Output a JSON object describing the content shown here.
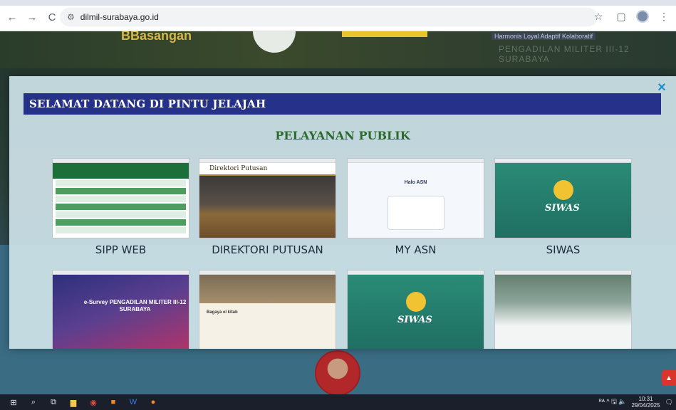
{
  "browser": {
    "url": "dilmil-surabaya.go.id",
    "nav": {
      "back": "←",
      "forward": "→",
      "reload": "C"
    },
    "icons": {
      "tune": "site-settings-icon",
      "star": "bookmark-star-icon",
      "extensions": "extensions-icon",
      "profile": "profile-avatar-icon",
      "menu": "kebab-menu-icon"
    }
  },
  "site_header": {
    "motto": "Harmonis Loyal Adaptif Kolaboratif",
    "subtitle": "PENGADILAN MILITER III-12 SURABAYA",
    "left_word": "BBasangan"
  },
  "modal": {
    "close_label": "×",
    "banner": "SELAMAT DATANG DI PINTU JELAJAH",
    "section_title": "PELAYANAN PUBLIK",
    "cards": [
      {
        "label": "SIPP WEB",
        "thumb": "sipp"
      },
      {
        "label": "DIREKTORI PUTUSAN",
        "thumb": "direktori",
        "thumb_title": "Direktori Putusan"
      },
      {
        "label": "MY ASN",
        "thumb": "myasn",
        "thumb_title": "Halo ASN"
      },
      {
        "label": "SIWAS",
        "thumb": "siwas",
        "thumb_title": "SIWAS"
      },
      {
        "label": "",
        "thumb": "survey",
        "thumb_title": "e-Survey PENGADILAN MILITER III-12 SURABAYA"
      },
      {
        "label": "",
        "thumb": "lapor",
        "thumb_title": "Bagaya el kitab"
      },
      {
        "label": "",
        "thumb": "siwas2",
        "thumb_title": "SIWAS"
      },
      {
        "label": "",
        "thumb": "map"
      }
    ]
  },
  "taskbar": {
    "time": "10:31",
    "date": "29/04/2025",
    "tray": "ᴿᴬ ^ 🖫 🔈"
  },
  "colors": {
    "banner": "#26318a",
    "section_title": "#2c6a2e",
    "close": "#1a90d0"
  }
}
